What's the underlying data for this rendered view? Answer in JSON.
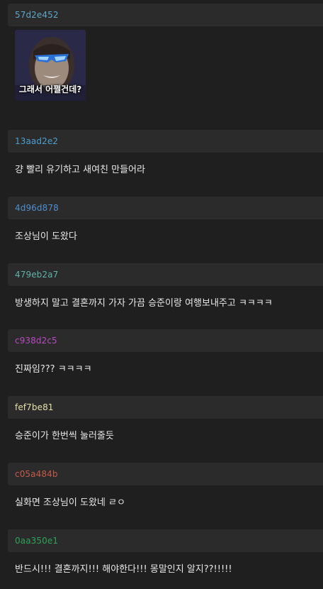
{
  "comments": [
    {
      "id": "57d2e452",
      "color": "#5fa6c9",
      "text": "",
      "image": {
        "caption": "그래서 어쩔건데?"
      }
    },
    {
      "id": "13aad2e2",
      "color": "#4d9fd0",
      "text": "걍 빨리 유기하고 새여친 만들어라"
    },
    {
      "id": "4d96d878",
      "color": "#4d8fce",
      "text": "조상님이 도왔다"
    },
    {
      "id": "479eb2a7",
      "color": "#5fb3a9",
      "text": "방생하지 말고 결혼까지 가자 가끔 승준이랑 여행보내주고 ㅋㅋㅋㅋ"
    },
    {
      "id": "c938d2c5",
      "color": "#b84bbf",
      "text": "진짜임??? ㅋㅋㅋㅋ"
    },
    {
      "id": "fef7be81",
      "color": "#e4e0a8",
      "text": "승준이가 한번씩 눌러줄듯"
    },
    {
      "id": "c05a484b",
      "color": "#c45a4c",
      "text": "실화면 조상님이 도왔네 ㄹㅇ"
    },
    {
      "id": "0aa350e1",
      "color": "#2fa25a",
      "text": "반드시!!! 결혼까지!!! 해야한다!!! 몽말인지 알지??!!!!!"
    }
  ]
}
